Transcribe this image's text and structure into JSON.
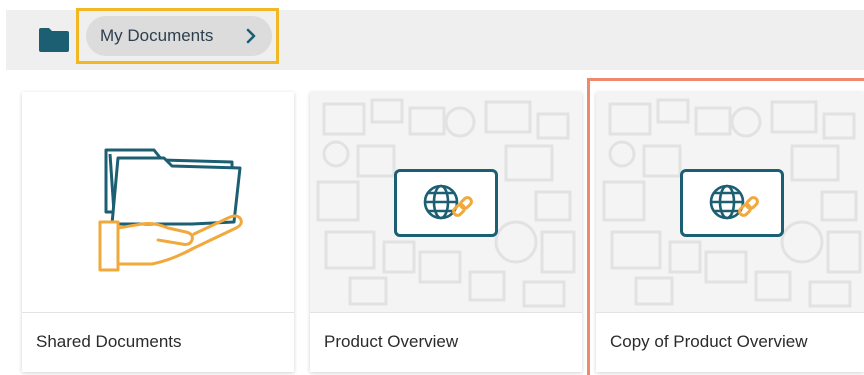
{
  "breadcrumb": {
    "root_icon": "folder-icon",
    "current": "My Documents",
    "chevron_icon": "chevron-right-icon",
    "highlight_color": "#f2b823"
  },
  "cards": [
    {
      "label": "Shared Documents",
      "icon": "folder-hand-icon"
    },
    {
      "label": "Product Overview",
      "icon": "web-link-icon"
    },
    {
      "label": "Copy of Product Overview",
      "icon": "web-link-icon",
      "highlighted": true
    }
  ],
  "colors": {
    "accent_dark": "#1c5f73",
    "accent_orange": "#f2a93b",
    "card_highlight": "#ec8a6b"
  }
}
